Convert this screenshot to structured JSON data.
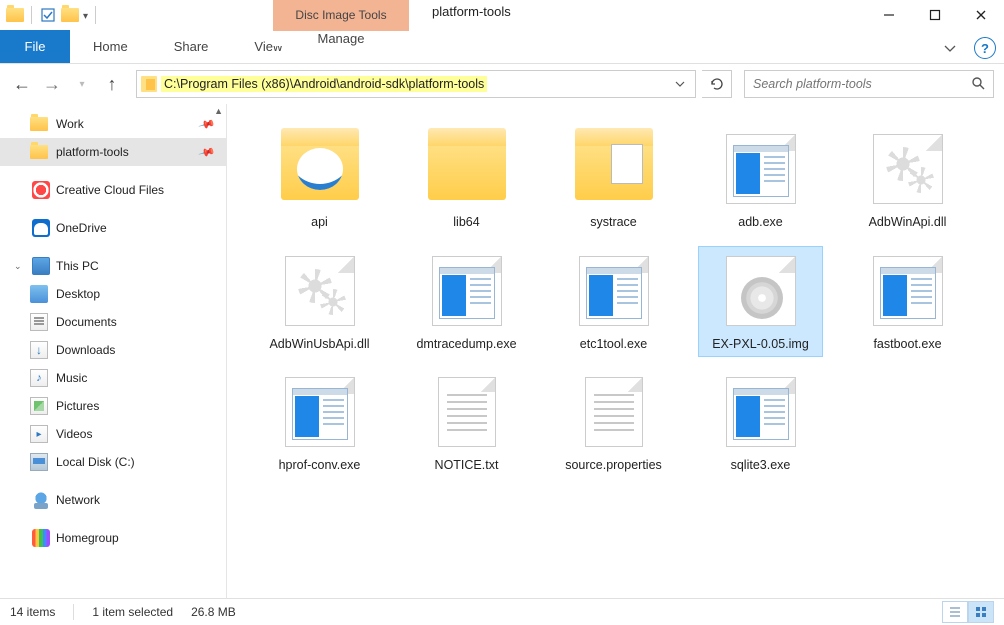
{
  "titlebar": {
    "context_tab": "Disc Image Tools",
    "window_title": "platform-tools"
  },
  "ribbon": {
    "file": "File",
    "tabs": [
      "Home",
      "Share",
      "View"
    ],
    "context_tab": "Manage"
  },
  "address": {
    "path": "C:\\Program Files (x86)\\Android\\android-sdk\\platform-tools"
  },
  "search": {
    "placeholder": "Search platform-tools"
  },
  "nav": {
    "quick": [
      {
        "name": "Work",
        "pinned": true
      },
      {
        "name": "platform-tools",
        "pinned": true,
        "selected": true
      }
    ],
    "items": [
      {
        "name": "Creative Cloud Files",
        "icon": "cc"
      },
      {
        "name": "OneDrive",
        "icon": "onedrive"
      }
    ],
    "thispc": {
      "label": "This PC",
      "children": [
        "Desktop",
        "Documents",
        "Downloads",
        "Music",
        "Pictures",
        "Videos",
        "Local Disk (C:)"
      ]
    },
    "network": "Network",
    "homegroup": "Homegroup"
  },
  "files": [
    {
      "name": "api",
      "type": "folder-api"
    },
    {
      "name": "lib64",
      "type": "folder"
    },
    {
      "name": "systrace",
      "type": "folder-pdf"
    },
    {
      "name": "adb.exe",
      "type": "exe"
    },
    {
      "name": "AdbWinApi.dll",
      "type": "dll"
    },
    {
      "name": "AdbWinUsbApi.dll",
      "type": "dll"
    },
    {
      "name": "dmtracedump.exe",
      "type": "exe"
    },
    {
      "name": "etc1tool.exe",
      "type": "exe"
    },
    {
      "name": "EX-PXL-0.05.img",
      "type": "img",
      "selected": true
    },
    {
      "name": "fastboot.exe",
      "type": "exe"
    },
    {
      "name": "hprof-conv.exe",
      "type": "exe"
    },
    {
      "name": "NOTICE.txt",
      "type": "txt"
    },
    {
      "name": "source.properties",
      "type": "txt"
    },
    {
      "name": "sqlite3.exe",
      "type": "exe"
    }
  ],
  "status": {
    "count": "14 items",
    "selection": "1 item selected",
    "size": "26.8 MB"
  }
}
